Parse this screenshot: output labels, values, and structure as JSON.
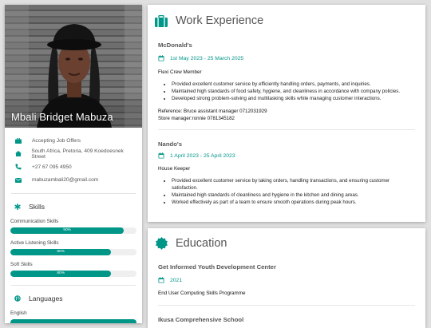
{
  "profile": {
    "name": "Mbali Bridget Mabuza",
    "contact": [
      {
        "icon": "briefcase-icon",
        "text": "Accepting Job Offers"
      },
      {
        "icon": "home-icon",
        "text": "South Africa, Pretoria, 409 Koedoesnek Street"
      },
      {
        "icon": "phone-icon",
        "text": "+27 67 095 4950"
      },
      {
        "icon": "envelope-icon",
        "text": "mabuzambali20@gmail.com"
      }
    ]
  },
  "skills": {
    "title": "Skills",
    "items": [
      {
        "name": "Communication Skills",
        "percent": 90,
        "label": "90%"
      },
      {
        "name": "Active Listening Skills",
        "percent": 80,
        "label": "80%"
      },
      {
        "name": "Soft Skills",
        "percent": 80,
        "label": "80%"
      }
    ]
  },
  "languages": {
    "title": "Languages",
    "items": [
      {
        "name": "English",
        "percent": 100,
        "label": ""
      }
    ]
  },
  "work": {
    "title": "Work Experience",
    "entries": [
      {
        "company": "McDonald's",
        "dates": "1st May 2023 - 25 March 2025",
        "role": "Flexi Crew Member",
        "bullets": [
          "Provided excellent customer service by efficiently handling orders, payments, and inquiries.",
          "Maintained high standards of food safety, hygiene, and cleanliness in accordance with company policies.",
          "Developed strong problem-solving and multitasking skills while managing customer interactions."
        ],
        "references": [
          "Reference: Bruce assistant manager 0712031929",
          "Store manager:ronnie 0781345182"
        ]
      },
      {
        "company": "Nando's",
        "dates": "1 April 2023 - 25 April 2023",
        "role": "House Keeper",
        "bullets": [
          "Provided excellent customer service by taking orders, handling transactions, and ensuring customer satisfaction.",
          "Maintained high standards of cleanliness and hygiene in the kitchen and dining areas.",
          "Worked effectively as part of a team to ensure smooth operations during peak hours."
        ]
      }
    ]
  },
  "education": {
    "title": "Education",
    "entries": [
      {
        "school": "Get Informed Youth Development Center",
        "date": "2021",
        "course": "End User Computing Skills Programme"
      },
      {
        "school": "Ikusa Comprehensive School"
      }
    ]
  },
  "colors": {
    "accent": "#009688",
    "background": "#e0e0e0",
    "card": "#ffffff"
  }
}
